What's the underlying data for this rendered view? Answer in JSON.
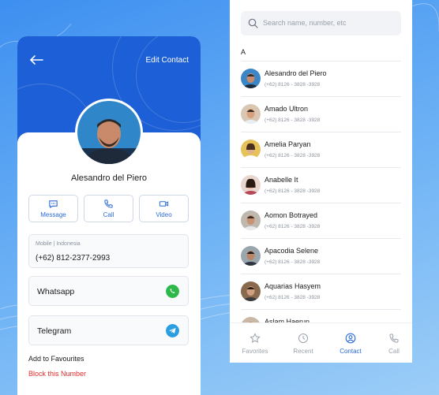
{
  "left": {
    "edit_label": "Edit Contact",
    "contact_name": "Alesandro del Piero",
    "actions": [
      {
        "label": "Message",
        "icon": "message-icon"
      },
      {
        "label": "Call",
        "icon": "phone-icon"
      },
      {
        "label": "Video",
        "icon": "video-icon"
      }
    ],
    "phone_label": "Mobile | Indonesia",
    "phone_value": "(+62) 812-2377-2993",
    "apps": [
      {
        "name": "Whatsapp",
        "icon": "whatsapp-icon",
        "color": "#2fb84a"
      },
      {
        "name": "Telegram",
        "icon": "telegram-icon",
        "color": "#2a9ee0"
      }
    ],
    "favourites_label": "Add to Favourites",
    "block_label": "Block this Number"
  },
  "right": {
    "search_placeholder": "Search name, number, etc",
    "section_letter": "A",
    "contacts": [
      {
        "name": "Alesandro del Piero",
        "phone": "(+62) 8126 - 3828 -3928"
      },
      {
        "name": "Amado Ultron",
        "phone": "(+62) 8126 - 3828 -3928"
      },
      {
        "name": "Amelia Paryan",
        "phone": "(+62) 8126 - 3828 -3928"
      },
      {
        "name": "Anabelle It",
        "phone": "(+62) 8126 - 3828 -3928"
      },
      {
        "name": "Aomon Botrayed",
        "phone": "(+62) 8126 - 3828 -3928"
      },
      {
        "name": "Apacodia Selene",
        "phone": "(+62) 8126 - 3828 -3928"
      },
      {
        "name": "Aquarias Hasyem",
        "phone": "(+62) 8126 - 3828 -3928"
      },
      {
        "name": "Aslam Haerun",
        "phone": ""
      }
    ],
    "tabs": [
      {
        "label": "Favorites",
        "icon": "star-icon"
      },
      {
        "label": "Recent",
        "icon": "clock-icon"
      },
      {
        "label": "Contact",
        "icon": "contact-icon",
        "active": true
      },
      {
        "label": "Call",
        "icon": "phone-icon"
      }
    ]
  },
  "colors": {
    "brand": "#1c5fd6",
    "accent": "#2b6ad8",
    "danger": "#e02b2b"
  }
}
